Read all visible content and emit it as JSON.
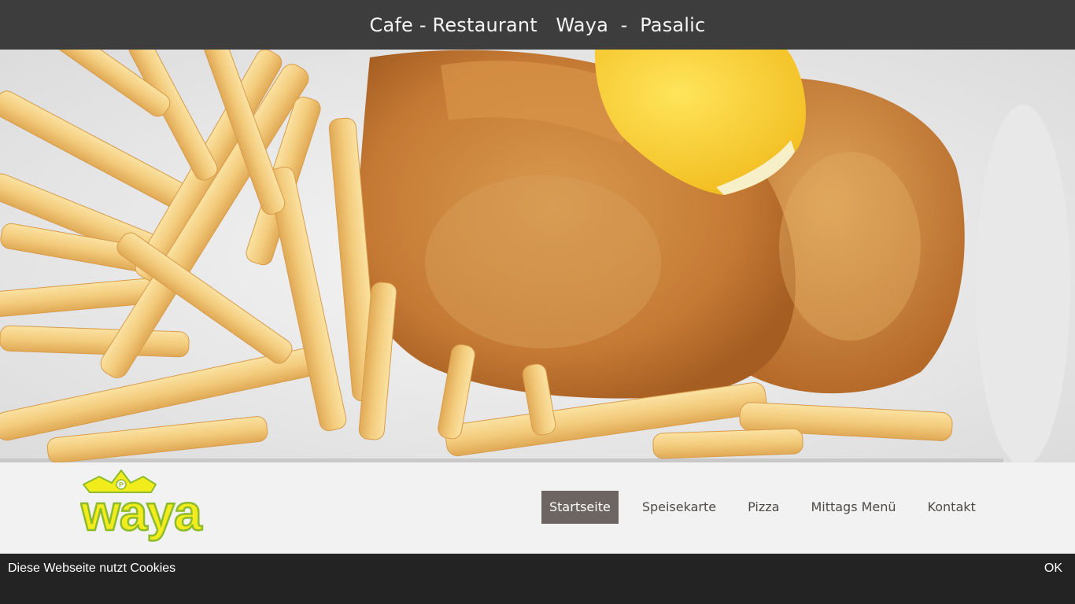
{
  "header": {
    "title": "Cafe - Restaurant   Waya  -  Pasalic"
  },
  "hero": {
    "image": "schnitzel-with-fries-and-lemon-photo"
  },
  "logo": {
    "text": "waya",
    "crown_letter": "P",
    "colors": {
      "fill": "#f2ec1c",
      "outline": "#8dbb2c"
    }
  },
  "nav": {
    "items": [
      {
        "label": "Startseite",
        "active": true
      },
      {
        "label": "Speisekarte",
        "active": false
      },
      {
        "label": "Pizza",
        "active": false
      },
      {
        "label": "Mittags Menü",
        "active": false
      },
      {
        "label": "Kontakt",
        "active": false
      }
    ],
    "active_color": "#6d6561"
  },
  "cookie": {
    "message": "Diese Webseite nutzt Cookies",
    "ok_label": "OK"
  }
}
